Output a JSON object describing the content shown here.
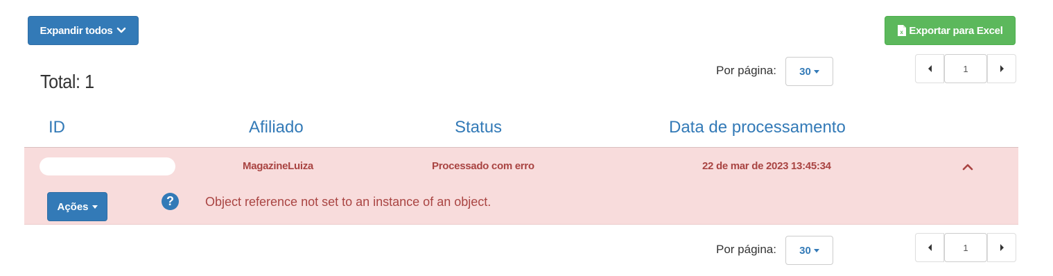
{
  "toolbar": {
    "expand_all_label": "Expandir todos",
    "export_label": "Exportar para Excel"
  },
  "summary": {
    "total_text": "Total: 1"
  },
  "pagination_top": {
    "per_page_label": "Por página:",
    "per_page_value": "30",
    "page_input_value": "1"
  },
  "pagination_bottom": {
    "per_page_label": "Por página:",
    "per_page_value": "30",
    "page_input_value": "1"
  },
  "table": {
    "headers": [
      "ID",
      "Afiliado",
      "Status",
      "Data de processamento"
    ],
    "rows": [
      {
        "id": "",
        "affiliate": "MagazineLuiza",
        "status": "Processado com erro",
        "processed_at": "22 de mar de 2023 13:45:34",
        "actions_label": "Ações",
        "error_message": "Object reference not set to an instance of an object."
      }
    ]
  },
  "icons": {
    "expand": "chevron-down-icon",
    "excel": "excel-file-icon",
    "collapse_row": "chevron-up-icon",
    "help": "question-circle-icon",
    "prev": "caret-left-icon",
    "next": "caret-right-icon"
  },
  "colors": {
    "primary": "#337ab7",
    "success": "#5cb85c",
    "danger_bg": "#f8dcdc",
    "danger_text": "#a94442"
  }
}
